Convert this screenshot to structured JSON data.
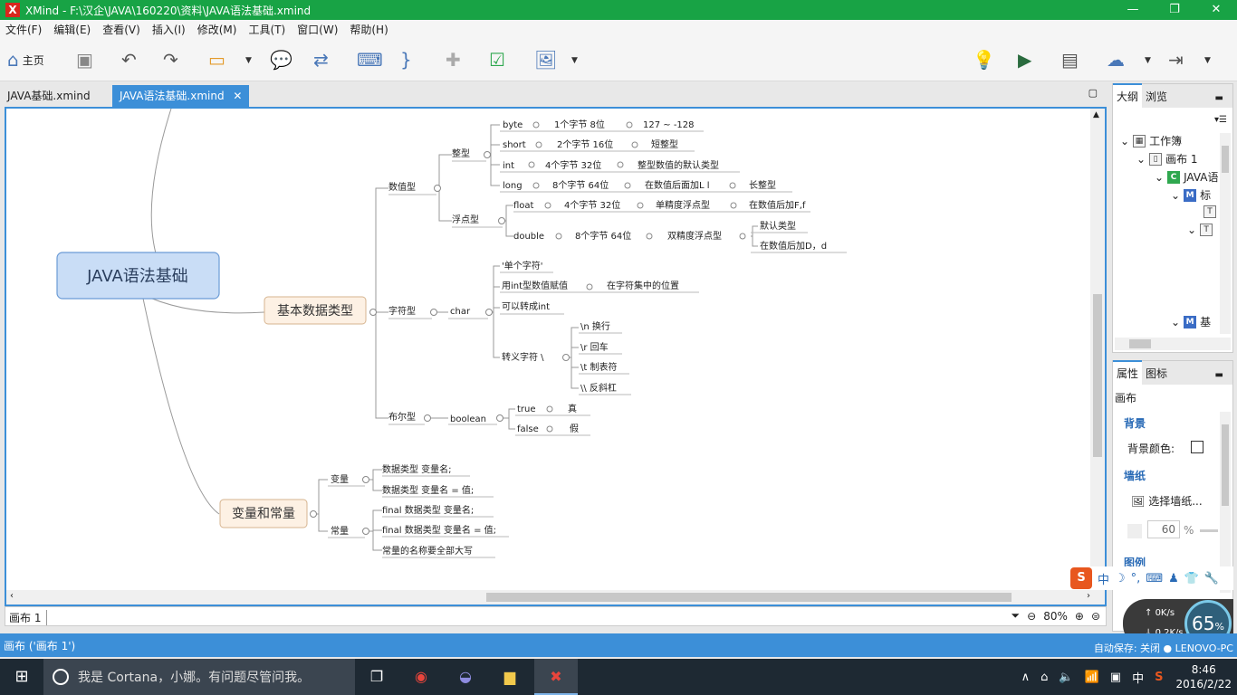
{
  "window": {
    "title": "XMind - F:\\汉企\\JAVA\\160220\\资料\\JAVA语法基础.xmind",
    "app_icon": "X"
  },
  "menu": [
    "文件(F)",
    "编辑(E)",
    "查看(V)",
    "插入(I)",
    "修改(M)",
    "工具(T)",
    "窗口(W)",
    "帮助(H)"
  ],
  "toolbar": {
    "home_label": "主页"
  },
  "tabs": [
    {
      "label": "JAVA基础.xmind",
      "active": false
    },
    {
      "label": "JAVA语法基础.xmind",
      "active": true
    }
  ],
  "mindmap": {
    "central": "JAVA语法基础",
    "nodes": {
      "basic_types": "基本数据类型",
      "var_const": "变量和常量",
      "numeric": "数值型",
      "integer": "整型",
      "byte": "byte",
      "byte_size": "1个字节 8位",
      "byte_range": "127 ~ -128",
      "short": "short",
      "short_size": "2个字节 16位",
      "short_note": "短整型",
      "int": "int",
      "int_size": "4个字节 32位",
      "int_note": "整型数值的默认类型",
      "long": "long",
      "long_size": "8个字节 64位",
      "long_suffix": "在数值后面加L l",
      "long_note": "长整型",
      "float_group": "浮点型",
      "float": "float",
      "float_size": "4个字节 32位",
      "float_note": "单精度浮点型",
      "float_suffix": "在数值后加F,f",
      "double": "double",
      "double_size": "8个字节 64位",
      "double_note": "双精度浮点型",
      "double_default": "默认类型",
      "double_suffix": "在数值后加D，d",
      "char_group": "字符型",
      "char": "char",
      "char_single": "'单个字符'",
      "char_int": "用int型数值赋值",
      "char_int_note": "在字符集中的位置",
      "char_convert": "可以转成int",
      "escape": "转义字符 \\",
      "esc_n": "\\n 换行",
      "esc_r": "\\r 回车",
      "esc_t": "\\t 制表符",
      "esc_bs": "\\\\ 反斜杠",
      "bool_group": "布尔型",
      "boolean": "boolean",
      "true": "true",
      "true_cn": "真",
      "false": "false",
      "false_cn": "假",
      "variable": "变量",
      "var_decl": "数据类型 变量名;",
      "var_assign": "数据类型 变量名 = 值;",
      "constant": "常量",
      "const_decl": "final 数据类型 变量名;",
      "const_assign": "final 数据类型 变量名 = 值;",
      "const_note": "常量的名称要全部大写"
    }
  },
  "sheet": {
    "tab": "画布 1",
    "zoom": "80%"
  },
  "outline_panel": {
    "tabs": [
      "大纲",
      "浏览"
    ],
    "workbook": "工作簿",
    "sheet": "画布 1",
    "root": "JAVA语",
    "node1": "标",
    "node2": "基"
  },
  "props_panel": {
    "tabs": [
      "属性",
      "图标"
    ],
    "scope": "画布",
    "background_section": "背景",
    "background_color": "背景颜色:",
    "wallpaper_section": "墙纸",
    "choose_wallpaper": "选择墙纸...",
    "opacity": "60",
    "opacity_unit": "%",
    "legend_section": "图例"
  },
  "status": {
    "left": "画布 ('画布 1')",
    "right": "自动保存: 关闭 ● LENOVO-PC"
  },
  "ime": {
    "items": [
      "中",
      "☽",
      "°,",
      "⌨",
      "♟",
      "👕",
      "🔧"
    ]
  },
  "speed": {
    "up": "0K/s",
    "down": "0.2K/s",
    "percent": "65"
  },
  "taskbar": {
    "cortana": "我是 Cortana，小娜。有问题尽管问我。",
    "ime": "中",
    "time": "8:46",
    "date": "2016/2/22"
  },
  "colors": {
    "titlebar": "#18a345",
    "accent": "#3c8fd8",
    "central_fill": "#c9ddf6",
    "central_stroke": "#6b9bd6",
    "main_fill": "#fdf1e4",
    "main_stroke": "#d6b48f"
  }
}
